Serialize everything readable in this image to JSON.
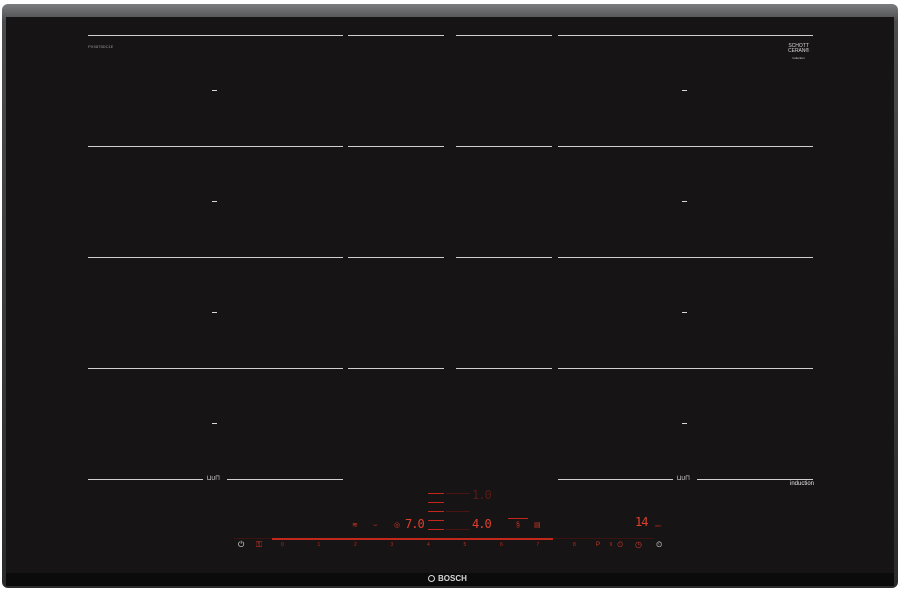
{
  "hob": {
    "model_code": "PXX875DC1E",
    "brand_mark_top": "SCHOTT",
    "brand_mark_bottom": "CERAN®",
    "brand_mark_sub": "Induction",
    "induction_label": "induction",
    "logo_text": "BOSCH",
    "flex_icon": "⊔∪⊓"
  },
  "displays": {
    "left_setting": "7.0",
    "center_top_setting": "1.0",
    "center_setting": "4.0",
    "timer": "14",
    "timer_unit": "min"
  },
  "slider": {
    "numbers": [
      "0",
      "1",
      "2",
      "3",
      "4",
      "5",
      "6",
      "7",
      "8",
      "9"
    ],
    "level": 0.67
  },
  "controls": {
    "power": "⏻",
    "childlock": "⚿",
    "boost": "P",
    "clock": "◷",
    "timer_icon": "⏲"
  },
  "icons": {
    "wifi": "wifi-icon",
    "pan": "pan-icon",
    "flex": "flex-zone-icon",
    "ruler": "sensor-icon"
  }
}
